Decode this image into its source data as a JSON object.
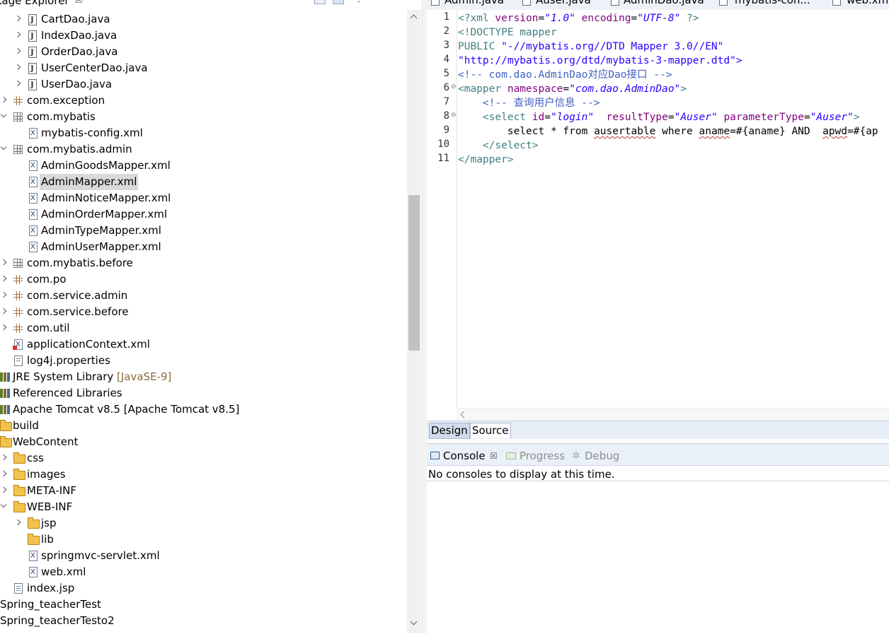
{
  "package_explorer": {
    "title": "kage Explorer",
    "close_glyph": "☒",
    "items": [
      {
        "label": "CartDao.java"
      },
      {
        "label": "IndexDao.java"
      },
      {
        "label": "OrderDao.java"
      },
      {
        "label": "UserCenterDao.java"
      },
      {
        "label": "UserDao.java"
      },
      {
        "label": "com.exception"
      },
      {
        "label": "com.mybatis"
      },
      {
        "label": "mybatis-config.xml"
      },
      {
        "label": "com.mybatis.admin"
      },
      {
        "label": "AdminGoodsMapper.xml"
      },
      {
        "label": "AdminMapper.xml"
      },
      {
        "label": "AdminNoticeMapper.xml"
      },
      {
        "label": "AdminOrderMapper.xml"
      },
      {
        "label": "AdminTypeMapper.xml"
      },
      {
        "label": "AdminUserMapper.xml"
      },
      {
        "label": "com.mybatis.before"
      },
      {
        "label": "com.po"
      },
      {
        "label": "com.service.admin"
      },
      {
        "label": "com.service.before"
      },
      {
        "label": "com.util"
      },
      {
        "label": "applicationContext.xml"
      },
      {
        "label": "log4j.properties"
      },
      {
        "label": "JRE System Library",
        "decoration": "[JavaSE-9]"
      },
      {
        "label": "Referenced Libraries"
      },
      {
        "label": "Apache Tomcat v8.5 [Apache Tomcat v8.5]"
      },
      {
        "label": "build"
      },
      {
        "label": "WebContent"
      },
      {
        "label": "css"
      },
      {
        "label": "images"
      },
      {
        "label": "META-INF"
      },
      {
        "label": "WEB-INF"
      },
      {
        "label": "jsp"
      },
      {
        "label": "lib"
      },
      {
        "label": "springmvc-servlet.xml"
      },
      {
        "label": "web.xml"
      },
      {
        "label": "index.jsp"
      },
      {
        "label": "Spring_teacherTest"
      },
      {
        "label": "Spring_teacherTesto2"
      }
    ]
  },
  "editor": {
    "tabs": [
      "Admin.java",
      "Auser.java",
      "AdminDao.java",
      "mybatis-con...",
      "web.xml"
    ],
    "lines": [
      {
        "n": "1"
      },
      {
        "n": "2"
      },
      {
        "n": "3"
      },
      {
        "n": "4"
      },
      {
        "n": "5"
      },
      {
        "n": "6"
      },
      {
        "n": "7"
      },
      {
        "n": "8"
      },
      {
        "n": "9"
      },
      {
        "n": "10"
      },
      {
        "n": "11"
      }
    ],
    "code": {
      "l1": {
        "a": "<?xml ",
        "b": "version",
        "c": "=",
        "d": "\"1.0\"",
        "e": " ",
        "f": "encoding",
        "g": "=",
        "h": "\"UTF-8\"",
        "i": " ?>"
      },
      "l2": "<!DOCTYPE mapper",
      "l3": {
        "a": "PUBLIC ",
        "b": "\"-//mybatis.org//DTD Mapper 3.0//EN\""
      },
      "l4": "\"http://mybatis.org/dtd/mybatis-3-mapper.dtd\">",
      "l5": "<!-- com.dao.AdminDao对应Dao接口 -->",
      "l6": {
        "a": "<mapper ",
        "b": "namespace",
        "c": "=",
        "d": "\"com.dao.AdminDao\"",
        "e": ">"
      },
      "l7": "    <!-- 查询用户信息 -->",
      "l8": {
        "a": "    <select ",
        "b": "id",
        "c": "=",
        "d": "\"login\"",
        "e": "  ",
        "f": "resultType",
        "g": "=",
        "h": "\"Auser\"",
        "i": " ",
        "j": "parameterType",
        "k": "=",
        "l": "\"Auser\"",
        "m": ">"
      },
      "l9": {
        "a": "        select * from ",
        "b": "ausertable",
        "c": " where ",
        "d": "aname",
        "e": "=#{aname} AND  ",
        "f": "apwd",
        "g": "=#{ap"
      },
      "l10": "    </select>",
      "l11": "</mapper>"
    },
    "bottom_tabs": {
      "design": "Design",
      "source": "Source"
    }
  },
  "console": {
    "tabs": {
      "console": "Console",
      "progress": "Progress",
      "debug": "Debug"
    },
    "close_glyph": "☒",
    "message": "No consoles to display at this time."
  },
  "colors": {
    "tag": "#3f7f7f",
    "attr": "#7f007f",
    "value": "#2a00ff",
    "comment": "#3f5fbf",
    "selection": "#d9d9d9"
  }
}
